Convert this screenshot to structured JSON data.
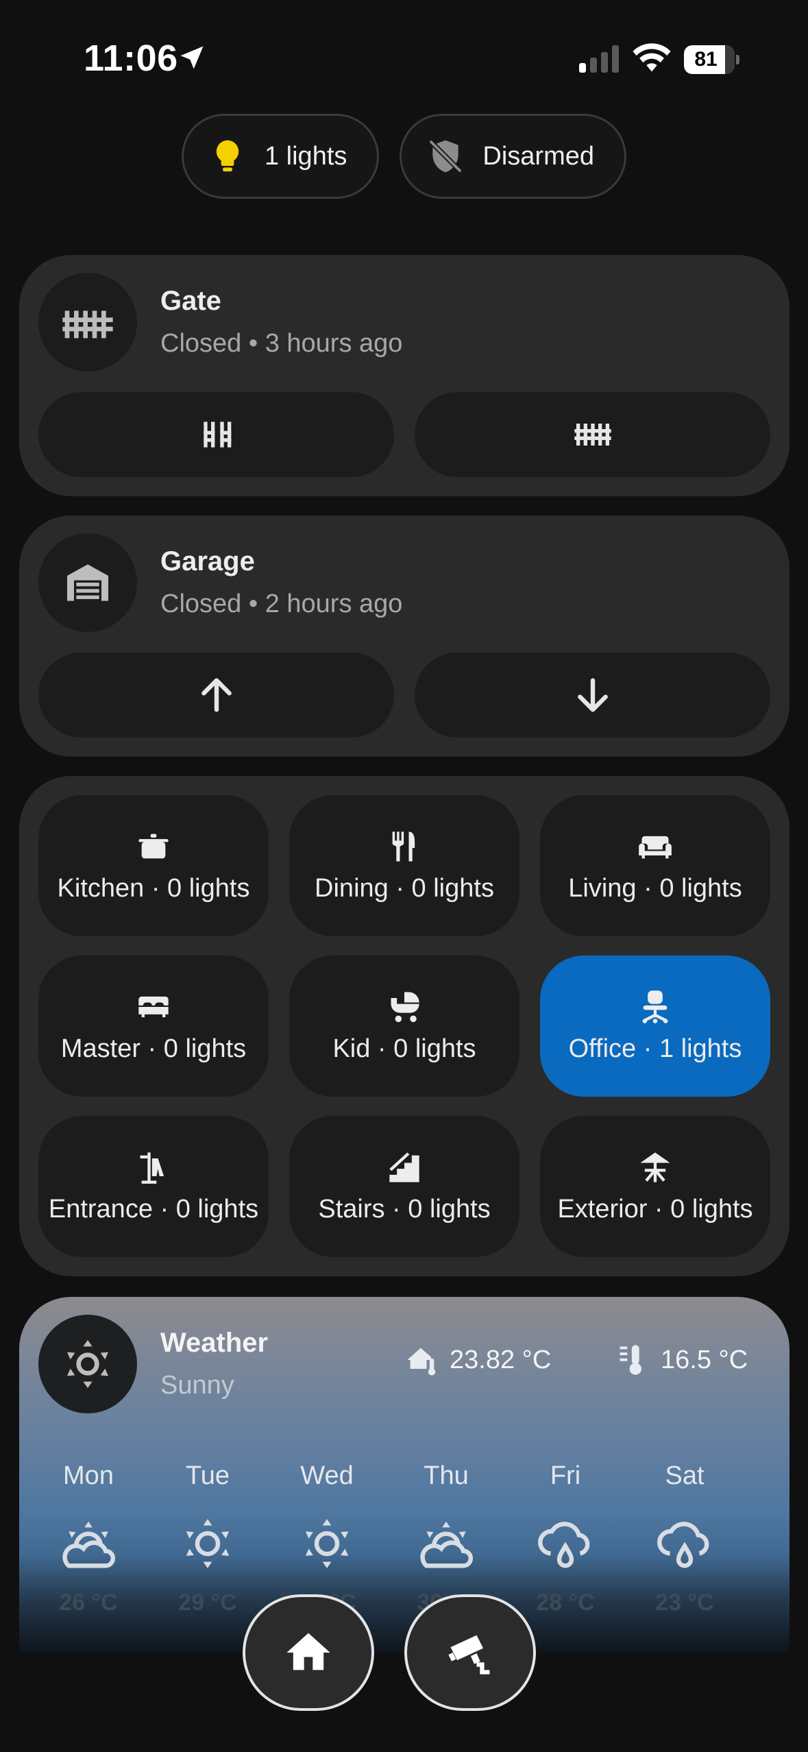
{
  "status": {
    "time": "11:06",
    "battery": "81",
    "battery_level": 0.81
  },
  "chips": {
    "lights_label": "1 lights",
    "alarm_label": "Disarmed"
  },
  "gate": {
    "title": "Gate",
    "status": "Closed • 3 hours ago"
  },
  "garage": {
    "title": "Garage",
    "status": "Closed • 2 hours ago"
  },
  "rooms": [
    {
      "label": "Kitchen · 0 lights",
      "icon": "pot-icon",
      "active": false
    },
    {
      "label": "Dining · 0 lights",
      "icon": "silverware-icon",
      "active": false
    },
    {
      "label": "Living · 0 lights",
      "icon": "sofa-icon",
      "active": false
    },
    {
      "label": "Master · 0 lights",
      "icon": "bed-icon",
      "active": false
    },
    {
      "label": "Kid · 0 lights",
      "icon": "baby-carriage-icon",
      "active": false
    },
    {
      "label": "Office · 1 lights",
      "icon": "office-chair-icon",
      "active": true
    },
    {
      "label": "Entrance · 0 lights",
      "icon": "coat-rack-icon",
      "active": false
    },
    {
      "label": "Stairs · 0 lights",
      "icon": "stairs-icon",
      "active": false
    },
    {
      "label": "Exterior · 0 lights",
      "icon": "patio-umbrella-icon",
      "active": false
    }
  ],
  "weather": {
    "title": "Weather",
    "condition": "Sunny",
    "indoor_temp": "23.82 °C",
    "outdoor_temp": "16.5 °C",
    "forecast": [
      {
        "day": "Mon",
        "icon": "partly-cloudy-icon",
        "temp": "26 °C"
      },
      {
        "day": "Tue",
        "icon": "sunny-icon",
        "temp": "29 °C"
      },
      {
        "day": "Wed",
        "icon": "sunny-icon",
        "temp": "30 °C"
      },
      {
        "day": "Thu",
        "icon": "partly-cloudy-icon",
        "temp": "30 °C"
      },
      {
        "day": "Fri",
        "icon": "rainy-icon",
        "temp": "28 °C"
      },
      {
        "day": "Sat",
        "icon": "rainy-icon",
        "temp": "23 °C"
      }
    ]
  },
  "colors": {
    "accent": "#0a6abf",
    "card": "#2a2a2a",
    "tile": "#1c1c1c",
    "bulb": "#f5d000"
  }
}
